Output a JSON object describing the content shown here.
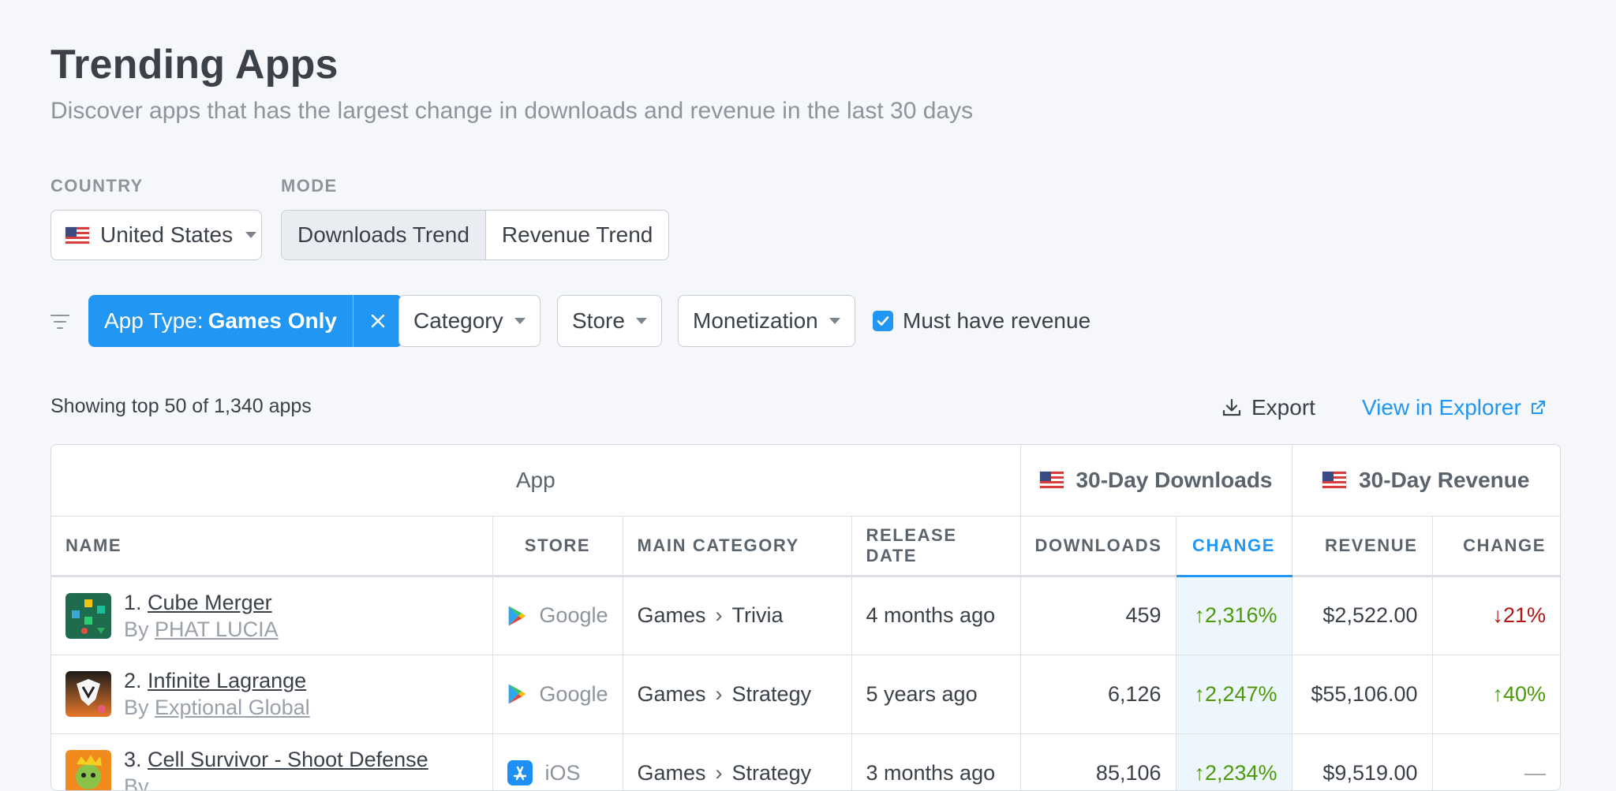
{
  "header": {
    "title": "Trending Apps",
    "subtitle": "Discover apps that has the largest change in downloads and revenue in the last 30 days"
  },
  "country": {
    "label": "COUNTRY",
    "value": "United States",
    "flag_icon": "us-flag-icon"
  },
  "mode": {
    "label": "MODE",
    "options": [
      "Downloads Trend",
      "Revenue Trend"
    ],
    "selected": "Downloads Trend"
  },
  "filters": {
    "app_type_prefix": "App Type:",
    "app_type_value": "Games Only",
    "category": "Category",
    "store": "Store",
    "monetization": "Monetization",
    "must_have_revenue_label": "Must have revenue",
    "must_have_revenue_checked": true
  },
  "toolbar": {
    "showing": "Showing top 50 of 1,340 apps",
    "export": "Export",
    "view_in_explorer": "View in Explorer"
  },
  "table": {
    "groups": {
      "app": "App",
      "downloads": "30-Day Downloads",
      "revenue": "30-Day Revenue"
    },
    "columns": [
      "NAME",
      "STORE",
      "MAIN CATEGORY",
      "RELEASE DATE",
      "DOWNLOADS",
      "CHANGE",
      "REVENUE",
      "CHANGE"
    ],
    "rows": [
      {
        "rank": "1.",
        "name": "Cube Merger",
        "by": "By",
        "developer": "PHAT LUCIA",
        "store": "Google",
        "category": "Games",
        "subcategory": "Trivia",
        "release": "4 months ago",
        "downloads": "459",
        "dl_change": "2,316%",
        "revenue": "$2,522.00",
        "rev_change": "21%"
      },
      {
        "rank": "2.",
        "name": "Infinite Lagrange",
        "by": "By",
        "developer": "Exptional Global",
        "store": "Google",
        "category": "Games",
        "subcategory": "Strategy",
        "release": "5 years ago",
        "downloads": "6,126",
        "dl_change": "2,247%",
        "revenue": "$55,106.00",
        "rev_change": "40%"
      },
      {
        "rank": "3.",
        "name": "Cell Survivor - Shoot Defense",
        "by": "By",
        "developer": "",
        "store": "iOS",
        "category": "Games",
        "subcategory": "Strategy",
        "release": "3 months ago",
        "downloads": "85,106",
        "dl_change": "2,234%",
        "revenue": "$9,519.00",
        "rev_change": "—"
      }
    ]
  },
  "colors": {
    "accent": "#2196f3",
    "up": "#4d9a08",
    "down": "#b11515"
  }
}
